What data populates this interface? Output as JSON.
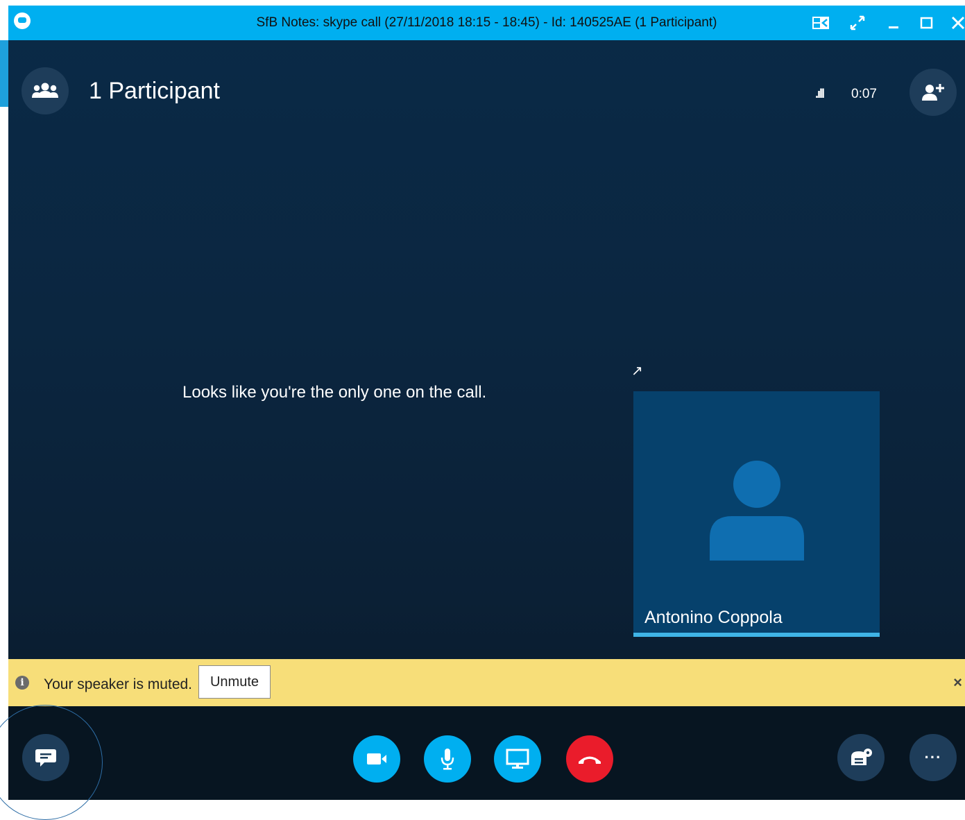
{
  "window": {
    "title": "SfB Notes: skype call  (27/11/2018 18:15 -  18:45) - Id: 140525AE (1 Participant)"
  },
  "header": {
    "participants_label": "1 Participant",
    "signal_glyph": ".ıll",
    "call_timer": "0:07"
  },
  "stage": {
    "empty_message": "Looks like you're the only one on the call.",
    "popout_glyph": "↗"
  },
  "tile": {
    "name": "Antonino Coppola"
  },
  "banner": {
    "info_glyph": "i",
    "message": "Your speaker is muted.",
    "unmute_label": "Unmute",
    "close_glyph": "×"
  },
  "controls": {
    "more_glyph": "···"
  },
  "colors": {
    "titlebar": "#00aff0",
    "banner": "#f7de79",
    "hangup": "#ea1c2b",
    "accent": "#00aff0"
  },
  "icons": [
    "skype-logo-icon",
    "compact-view-icon",
    "fullscreen-icon",
    "minimize-icon",
    "maximize-icon",
    "close-icon",
    "participants-icon",
    "add-participant-icon",
    "popout-icon",
    "info-icon",
    "chat-icon",
    "video-icon",
    "microphone-icon",
    "screen-share-icon",
    "hang-up-icon",
    "call-controls-icon",
    "more-options-icon"
  ]
}
